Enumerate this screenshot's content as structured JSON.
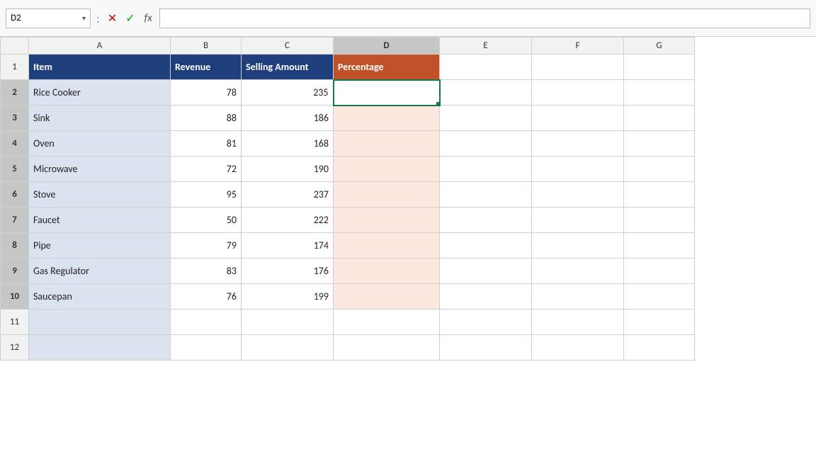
{
  "formulaBar": {
    "nameBox": "D2",
    "nameBoxArrow": "▾",
    "divider": ":",
    "cancelIcon": "✕",
    "confirmIcon": "✓",
    "fxLabel": "fx",
    "formulaValue": ""
  },
  "columns": {
    "headers": [
      "A",
      "B",
      "C",
      "D",
      "E",
      "F",
      "G"
    ]
  },
  "rows": [
    {
      "rowNum": "1",
      "cells": [
        "Item",
        "Revenue",
        "Selling Amount",
        "Percentage",
        "",
        "",
        ""
      ]
    },
    {
      "rowNum": "2",
      "cells": [
        "Rice Cooker",
        "78",
        "235",
        "",
        "",
        "",
        ""
      ]
    },
    {
      "rowNum": "3",
      "cells": [
        "Sink",
        "88",
        "186",
        "",
        "",
        "",
        ""
      ]
    },
    {
      "rowNum": "4",
      "cells": [
        "Oven",
        "81",
        "168",
        "",
        "",
        "",
        ""
      ]
    },
    {
      "rowNum": "5",
      "cells": [
        "Microwave",
        "72",
        "190",
        "",
        "",
        "",
        ""
      ]
    },
    {
      "rowNum": "6",
      "cells": [
        "Stove",
        "95",
        "237",
        "",
        "",
        "",
        ""
      ]
    },
    {
      "rowNum": "7",
      "cells": [
        "Faucet",
        "50",
        "222",
        "",
        "",
        "",
        ""
      ]
    },
    {
      "rowNum": "8",
      "cells": [
        "Pipe",
        "79",
        "174",
        "",
        "",
        "",
        ""
      ]
    },
    {
      "rowNum": "9",
      "cells": [
        "Gas Regulator",
        "83",
        "176",
        "",
        "",
        "",
        ""
      ]
    },
    {
      "rowNum": "10",
      "cells": [
        "Saucepan",
        "76",
        "199",
        "",
        "",
        "",
        ""
      ]
    },
    {
      "rowNum": "11",
      "cells": [
        "",
        "",
        "",
        "",
        "",
        "",
        ""
      ]
    },
    {
      "rowNum": "12",
      "cells": [
        "",
        "",
        "",
        "",
        "",
        "",
        ""
      ]
    }
  ]
}
